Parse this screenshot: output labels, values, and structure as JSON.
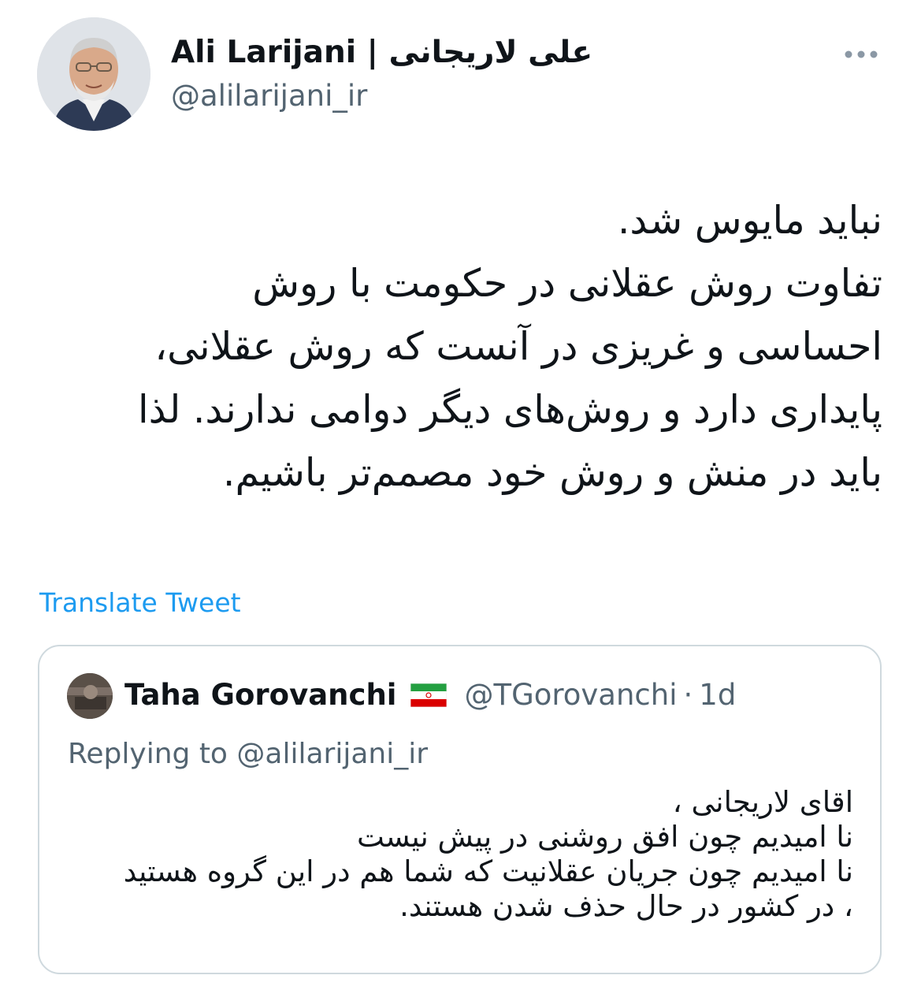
{
  "tweet": {
    "author": {
      "name": "Ali Larijani | علی لاریجانی",
      "handle": "@alilarijani_ir",
      "avatar_icon": "profile-photo"
    },
    "more_icon": "more-horizontal-icon",
    "text_lines": [
      "نباید مایوس شد.",
      "تفاوت روش عقلانی در حکومت با روش",
      "احساسی و غریزی در آنست که روش عقلانی،",
      "پایداری دارد و روش‌های دیگر دوامی ندارند. لذا",
      "باید در منش و روش خود مصمم‌تر باشیم."
    ],
    "translate_label": "Translate Tweet"
  },
  "quoted_tweet": {
    "name": "Taha Gorovanchi",
    "flag_icon": "iran-flag-icon",
    "handle": "@TGorovanchi",
    "separator": "·",
    "time": "1d",
    "replying_prefix": "Replying to",
    "replying_handle": "@alilarijani_ir",
    "text_lines": [
      "اقای لاریجانی ،",
      "نا امیدیم چون افق روشنی در پیش نیست",
      "نا امیدیم چون جریان عقلانیت که شما هم در این گروه هستید",
      "، در کشور در حال حذف شدن هستند."
    ]
  },
  "colors": {
    "text_primary": "#0f1419",
    "text_secondary": "#536471",
    "link": "#1d9bf0",
    "border": "#cfd9de"
  }
}
